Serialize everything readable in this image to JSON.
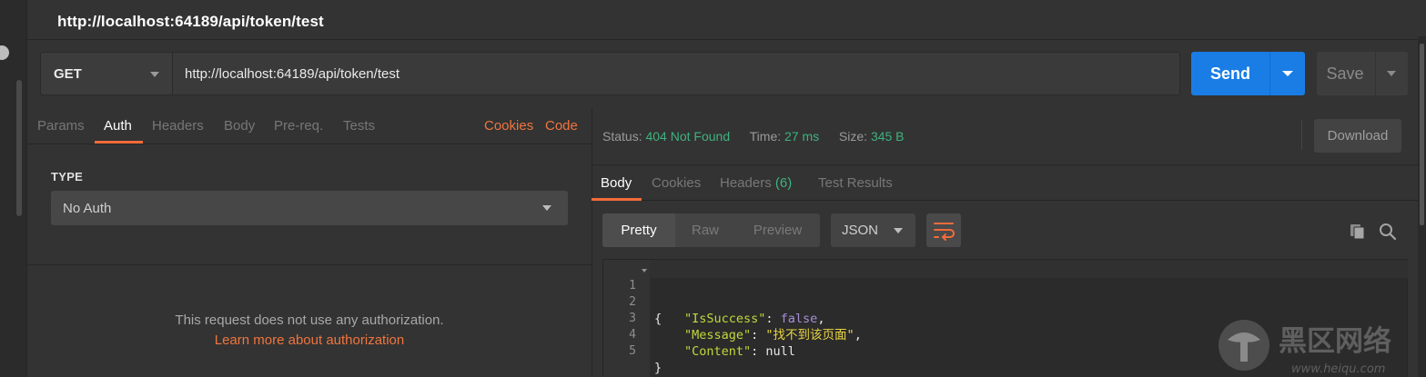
{
  "title": "http://localhost:64189/api/token/test",
  "request": {
    "method": "GET",
    "url": "http://localhost:64189/api/token/test",
    "send_label": "Send",
    "save_label": "Save"
  },
  "request_tabs": {
    "params": "Params",
    "auth": "Auth",
    "headers": "Headers",
    "body": "Body",
    "prereq": "Pre-req.",
    "tests": "Tests",
    "cookies": "Cookies",
    "code": "Code"
  },
  "auth": {
    "type_label": "TYPE",
    "type_value": "No Auth",
    "message": "This request does not use any authorization.",
    "learn_more": "Learn more about authorization"
  },
  "response": {
    "status_label": "Status:",
    "status_value": "404 Not Found",
    "time_label": "Time:",
    "time_value": "27 ms",
    "size_label": "Size:",
    "size_value": "345 B",
    "download_label": "Download",
    "tabs": {
      "body": "Body",
      "cookies": "Cookies",
      "headers": "Headers",
      "headers_count": "(6)",
      "test_results": "Test Results"
    },
    "formats": {
      "pretty": "Pretty",
      "raw": "Raw",
      "preview": "Preview",
      "language": "JSON"
    },
    "body_lines": {
      "n1": "1",
      "n2": "2",
      "n3": "3",
      "n4": "4",
      "n5": "5",
      "l1": "{",
      "l2_key": "\"IsSuccess\"",
      "l2_sep": ": ",
      "l2_val": "false",
      "l2_end": ",",
      "l3_key": "\"Message\"",
      "l3_sep": ": ",
      "l3_val": "\"找不到该页面\"",
      "l3_end": ",",
      "l4_key": "\"Content\"",
      "l4_sep": ": ",
      "l4_val": "null",
      "l5": "}"
    }
  },
  "watermark": {
    "text": "黑区网络",
    "url": "www.heiqu.com"
  },
  "colors": {
    "accent": "#f26b3a",
    "send": "#1a7de5",
    "status_green": "#3fb27f"
  }
}
